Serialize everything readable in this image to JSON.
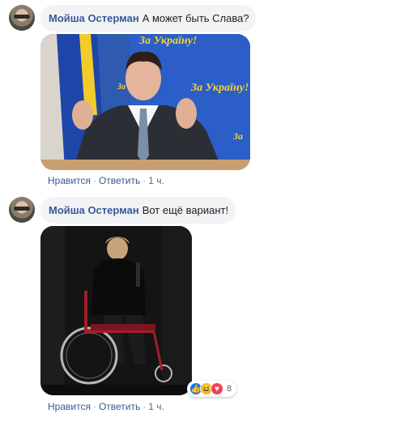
{
  "comments": [
    {
      "author": "Мойша Остерман",
      "text": "А может быть Слава?",
      "image_banner_text": "За Україну!",
      "actions": {
        "like": "Нравится",
        "reply": "Ответить",
        "time": "1 ч."
      }
    },
    {
      "author": "Мойша Остерман",
      "text": "Вот ещё вариант!",
      "actions": {
        "like": "Нравится",
        "reply": "Ответить",
        "time": "1 ч."
      },
      "reactions": {
        "icons": [
          "like-icon",
          "haha-icon",
          "love-icon"
        ],
        "count": "8"
      }
    }
  ],
  "colors": {
    "author": "#385898",
    "bubble": "#f2f3f5",
    "meta": "#606770"
  }
}
